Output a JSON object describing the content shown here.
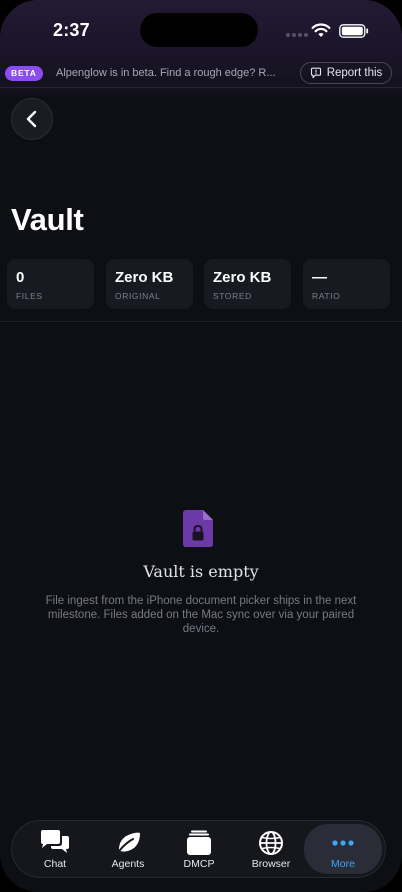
{
  "status_bar": {
    "time": "2:37"
  },
  "beta_banner": {
    "badge": "BETA",
    "text": "Alpenglow is in beta. Find a rough edge? R...",
    "report_label": "Report this"
  },
  "page": {
    "title": "Vault"
  },
  "stats": [
    {
      "value": "0",
      "label": "FILES"
    },
    {
      "value": "Zero KB",
      "label": "ORIGINAL"
    },
    {
      "value": "Zero KB",
      "label": "STORED"
    },
    {
      "value": "—",
      "label": "RATIO"
    }
  ],
  "empty_state": {
    "icon": "locked-file-icon",
    "title": "Vault is empty",
    "description": "File ingest from the iPhone document picker ships in the next milestone. Files added on the Mac sync over via your paired device."
  },
  "tab_bar": {
    "items": [
      {
        "label": "Chat",
        "icon": "chat-icon"
      },
      {
        "label": "Agents",
        "icon": "leaf-icon"
      },
      {
        "label": "DMCP",
        "icon": "stack-icon"
      },
      {
        "label": "Browser",
        "icon": "globe-icon"
      },
      {
        "label": "More",
        "icon": "more-icon",
        "active": true
      }
    ]
  },
  "colors": {
    "accent_purple": "#8b4df0",
    "active_tab": "#3ea6f5",
    "background": "#0d0f15"
  }
}
